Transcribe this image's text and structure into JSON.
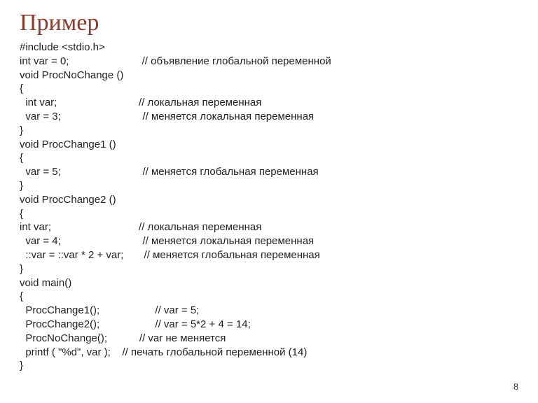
{
  "title": "Пример",
  "page_number": "8",
  "code": {
    "l01": "#include <stdio.h>",
    "l02": "int var = 0;                         // объявление глобальной переменной",
    "l03": "void ProcNoChange ()",
    "l04": "{",
    "l05": "  int var;                            // локальная переменная",
    "l06": "  var = 3;                            // меняется локальная переменная",
    "l07": "}",
    "l08": "void ProcChange1 ()",
    "l09": "{",
    "l10": "  var = 5;                            // меняется глобальная переменная",
    "l11": "}",
    "l12": "void ProcChange2 ()",
    "l13": "{",
    "l14": "int var;                              // локальная переменная",
    "l15": "  var = 4;                            // меняется локальная переменная",
    "l16": "  ::var = ::var * 2 + var;       // меняется глобальная переменная",
    "l17": "}",
    "l18": "void main()",
    "l19": "{",
    "l20": "  ProcChange1();                   // var = 5;",
    "l21": "  ProcChange2();                   // var = 5*2 + 4 = 14;",
    "l22": "  ProcNoChange();           // var не меняется",
    "l23": "  printf ( \"%d\", var );    // печать глобальной переменной (14)",
    "l24": "}"
  }
}
